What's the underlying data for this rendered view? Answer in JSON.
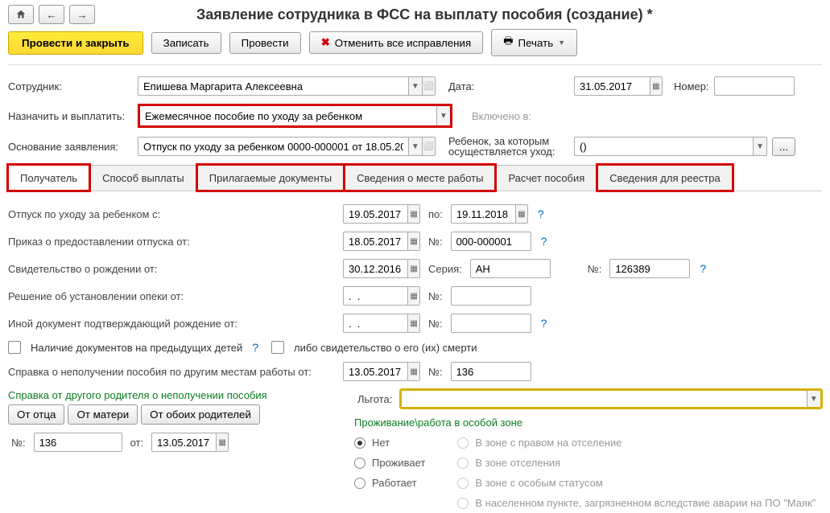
{
  "title": "Заявление сотрудника в ФСС на выплату пособия (создание) *",
  "toolbar": {
    "submit": "Провести и закрыть",
    "save": "Записать",
    "post": "Провести",
    "cancel": "Отменить все исправления",
    "print": "Печать"
  },
  "head": {
    "employee_lbl": "Сотрудник:",
    "employee": "Епишева Маргарита Алексеевна",
    "date_lbl": "Дата:",
    "date": "31.05.2017",
    "number_lbl": "Номер:",
    "number": "",
    "assign_lbl": "Назначить и выплатить:",
    "assign": "Ежемесячное пособие по уходу за ребенком",
    "included_lbl": "Включено в:",
    "basis_lbl": "Основание заявления:",
    "basis": "Отпуск по уходу за ребенком 0000-000001 от 18.05.2017",
    "child_lbl": "Ребенок, за которым осуществляется уход:",
    "child": "()"
  },
  "tabs": {
    "t1": "Получатель",
    "t2": "Способ выплаты",
    "t3": "Прилагаемые документы",
    "t4": "Сведения о месте работы",
    "t5": "Расчет пособия",
    "t6": "Сведения для реестра"
  },
  "form": {
    "leave_from_lbl": "Отпуск по уходу за ребенком с:",
    "leave_from": "19.05.2017",
    "leave_to_lbl": "по:",
    "leave_to": "19.11.2018",
    "order_lbl": "Приказ о предоставлении отпуска от:",
    "order_date": "18.05.2017",
    "order_no_lbl": "№:",
    "order_no": "000-000001",
    "birth_cert_lbl": "Свидетельство о рождении от:",
    "birth_cert_date": "30.12.2016",
    "series_lbl": "Серия:",
    "series": "АН",
    "birth_no_lbl": "№:",
    "birth_no": "126389",
    "guardianship_lbl": "Решение об установлении опеки от:",
    "guardianship_date": ".  .",
    "guardianship_no": "",
    "other_doc_lbl": "Иной документ подтверждающий рождение от:",
    "other_doc_date": ".  .",
    "other_doc_no": "",
    "prev_children_cb": "Наличие документов на предыдущих детей",
    "death_cb": "либо свидетельство о его (их) смерти",
    "nonreceipt_lbl": "Справка о неполучении пособия по другим местам работы от:",
    "nonreceipt_date": "13.05.2017",
    "nonreceipt_no": "136",
    "other_parent_lbl": "Справка от другого родителя о неполучении пособия",
    "father": "От отца",
    "mother": "От матери",
    "both": "От обоих родителей",
    "no_lbl": "№:",
    "ref_no": "136",
    "ref_from_lbl": "от:",
    "ref_date": "13.05.2017",
    "lgota_lbl": "Льгота:",
    "zone_lbl": "Проживание\\работа в особой зоне",
    "z_none": "Нет",
    "z_lives": "Проживает",
    "z_works": "Работает",
    "z_leave": "В зоне с правом на отселение",
    "z_otsel": "В зоне отселения",
    "z_status": "В зоне с особым статусом",
    "z_mayak": "В населенном пункте, загрязненном вследствие аварии на ПО \"Маяк\""
  }
}
